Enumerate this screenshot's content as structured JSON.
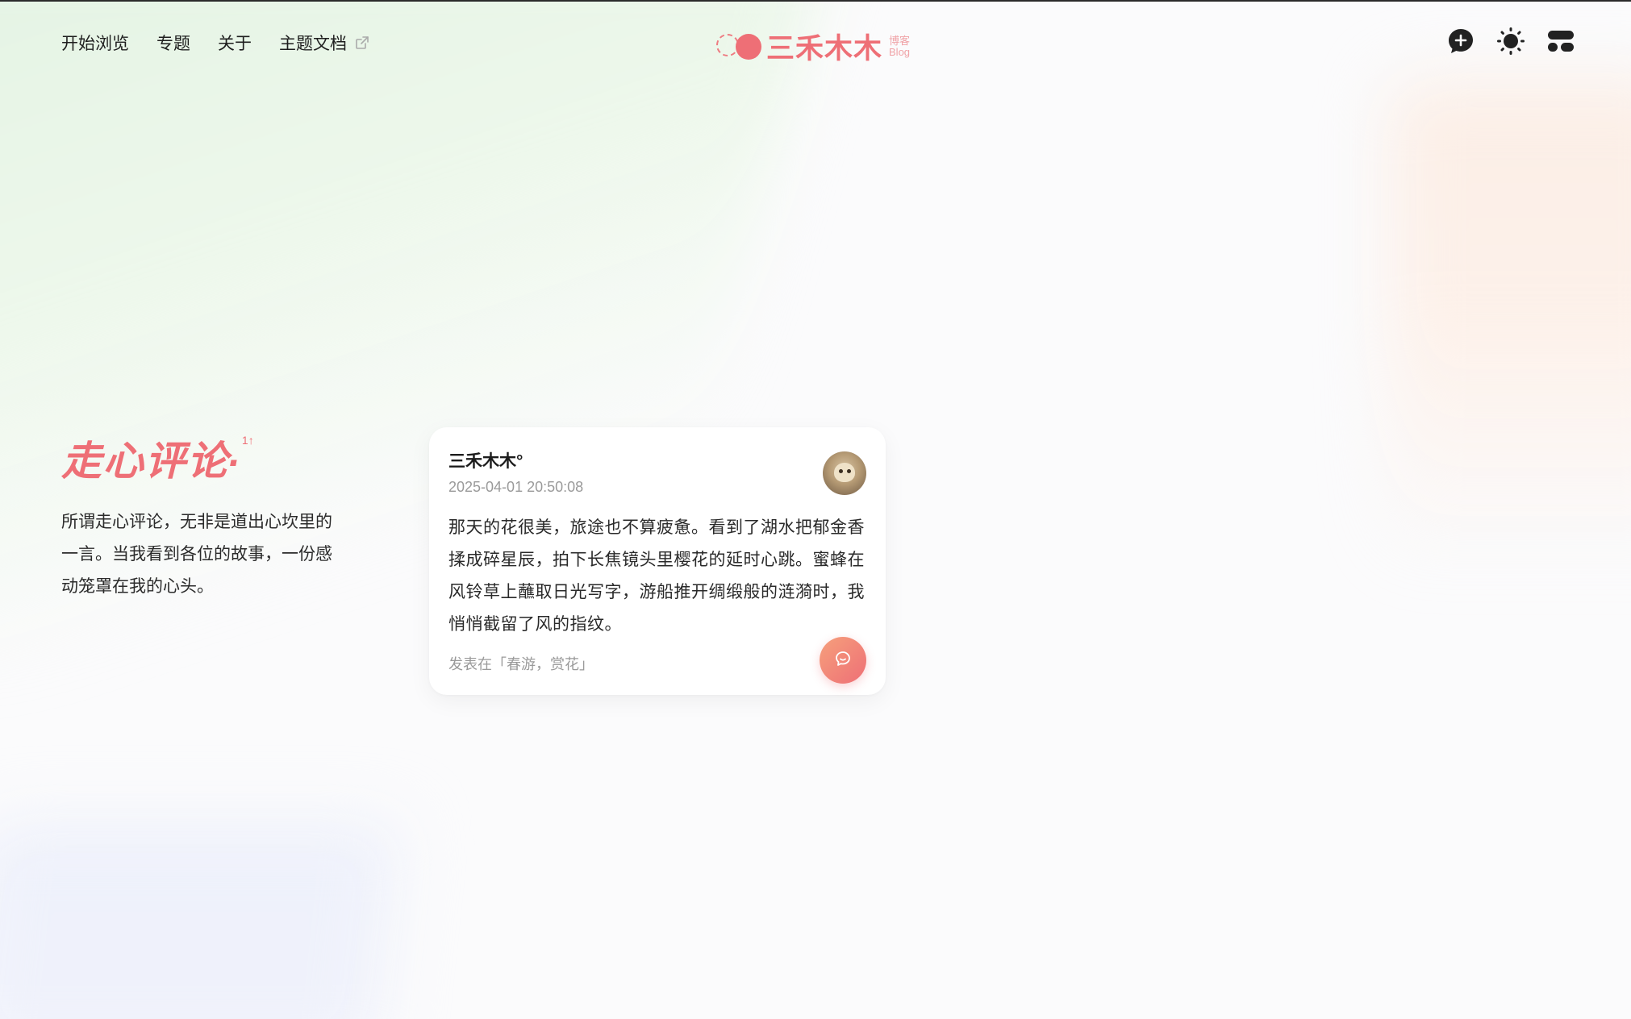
{
  "nav": {
    "links": [
      {
        "label": "开始浏览"
      },
      {
        "label": "专题"
      },
      {
        "label": "关于"
      },
      {
        "label": "主题文档",
        "external": true
      }
    ]
  },
  "logo": {
    "text": "三禾木木",
    "sub_top": "博客",
    "sub_bottom": "Blog"
  },
  "actions": {
    "icons": [
      "add-comment-icon",
      "sun-icon",
      "menu-icon"
    ]
  },
  "intro": {
    "title": "走心评论",
    "title_dot": ".",
    "title_sup": "1↑",
    "description": "所谓走心评论，无非是道出心坎里的一言。当我看到各位的故事，一份感动笼罩在我的心头。"
  },
  "comment": {
    "author": "三禾木木°",
    "time": "2025-04-01 20:50:08",
    "body": "那天的花很美，旅途也不算疲惫。看到了湖水把郁金香揉成碎星辰，拍下长焦镜头里樱花的延时心跳。蜜蜂在风铃草上蘸取日光写字，游船推开绸缎般的涟漪时，我悄悄截留了风的指纹。",
    "posted_in": "发表在「春游，赏花」"
  },
  "colors": {
    "accent": "#ee6f76",
    "accent_light": "#f6a07c"
  }
}
